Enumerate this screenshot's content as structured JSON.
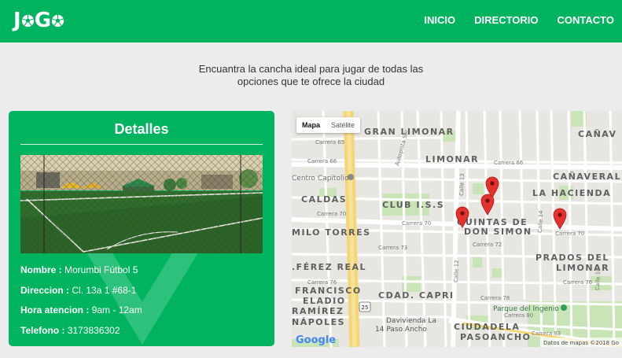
{
  "header": {
    "logo_text": "J",
    "logo_text2": "G",
    "nav": [
      {
        "label": "INICIO"
      },
      {
        "label": "DIRECTORIO"
      },
      {
        "label": "CONTACTO"
      }
    ],
    "bg_color": "#00b45f"
  },
  "tagline": {
    "line1": "Encuantra la cancha ideal para jugar de todas las",
    "line2": "opciones que te ofrece la ciudad"
  },
  "details": {
    "title": "Detalles",
    "fields": [
      {
        "label": "Nombre :",
        "value": "Morumbi Fútbol 5"
      },
      {
        "label": "Direccion :",
        "value": "Cl. 13a 1 #68-1"
      },
      {
        "label": "Hora atencion :",
        "value": "9am - 12am"
      },
      {
        "label": "Telefono :",
        "value": "3173836302"
      }
    ]
  },
  "map": {
    "tab_map": "Mapa",
    "tab_satellite": "Satélite",
    "footer": "Datos de mapas ©2018 Go",
    "google": "Google",
    "labels": {
      "gran_limonar": "GRAN LIMONAR",
      "limonar": "LIMONAR",
      "canaveral": "CAÑAVERAL",
      "canav": "CAÑAV",
      "la_hacienda": "LA HACIENDA",
      "caldas": "CALDAS",
      "club_iss": "CLUB I.S.S",
      "milo_torres": "MILO TORRES",
      "quintas1": "QUINTAS DE",
      "quintas2": "DON SIMON",
      "prados1": "PRADOS DEL",
      "prados2": "LIMONAR",
      "ferez_real": ".FÉREZ REAL",
      "francisco1": "FRANCISCO",
      "francisco2": "ELADIO",
      "francisco3": "RAMÍREZ",
      "napoles": "NÁPOLES",
      "cdad_capri": "CDAD. CAPRI",
      "ciudadela1": "CIUDADELA",
      "ciudadela2": "PASOANCHO",
      "centro_capitolio": "Centro Capitolio",
      "parque_ingenio": "Parque del Ingenio",
      "davivienda1": "Davivienda La",
      "davivienda2": "14 Paso Ancho",
      "carrera66": "Carrera 66",
      "carrera66b": "Carrera 66",
      "carrera65": "Carrera 65",
      "carrera70": "Carrera 70",
      "carrera70b": "Carrera 70",
      "carrera70c": "Carrera 70",
      "carrera72": "Carrera 72",
      "carrera73": "Carrera 73",
      "carrera76": "Carrera 76",
      "carrera76b": "Carrera 76",
      "carrera78": "Carrera 78",
      "carrera80": "Carrera 80",
      "carrera83": "Carrera 83",
      "calle13": "Calle 13",
      "calle12": "Calle 12",
      "calle14": "Calle 14",
      "calle16": "Calle 16",
      "autopista": "Autopista Sur",
      "route": "25"
    }
  }
}
